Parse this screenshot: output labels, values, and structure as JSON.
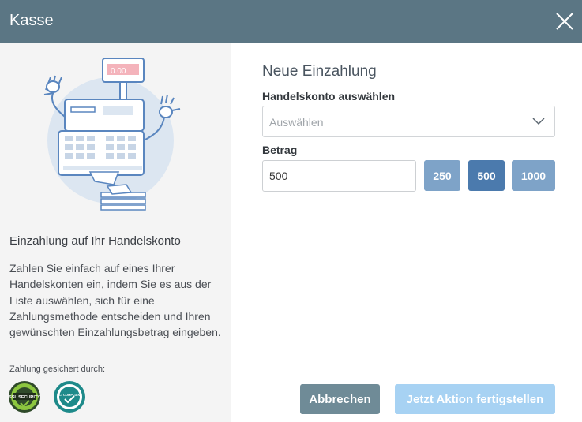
{
  "header": {
    "title": "Kasse"
  },
  "left": {
    "illustration_display": "0.00",
    "title": "Einzahlung auf Ihr Handelskonto",
    "description": "Zahlen Sie einfach auf eines Ihrer Handelskonten ein, indem Sie es aus der Liste auswählen, sich für eine Zahlungsmethode entscheiden und Ihren gewünschten Einzahlungsbetrag eingeben.",
    "secured_label": "Zahlung gesichert durch:",
    "badges": [
      {
        "icon": "ssl-security-badge-icon",
        "text": "SSL SECURITY"
      },
      {
        "icon": "pci-compliant-badge-icon",
        "text": "PCI COMPLIANT"
      }
    ]
  },
  "form": {
    "title": "Neue Einzahlung",
    "account_label": "Handelskonto auswählen",
    "account_placeholder": "Auswählen",
    "amount_label": "Betrag",
    "amount_value": "500",
    "presets": [
      "250",
      "500",
      "1000"
    ],
    "selected_preset": "500"
  },
  "actions": {
    "cancel": "Abbrechen",
    "submit": "Jetzt Aktion fertigstellen"
  },
  "colors": {
    "header_bg": "#5b7684",
    "chip": "#7ea3c8",
    "chip_selected": "#4b7aad",
    "cancel_bg": "#6f8b97",
    "submit_bg": "#a7d2f3"
  }
}
